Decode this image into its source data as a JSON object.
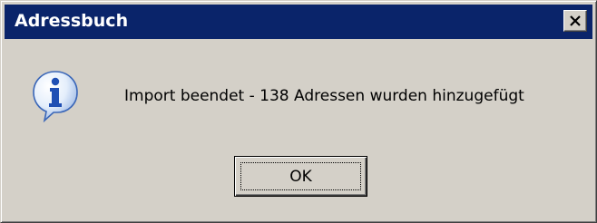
{
  "window": {
    "title": "Adressbuch"
  },
  "titlebar": {
    "close_icon": "close-icon",
    "background_color": "#0a246a"
  },
  "dialog": {
    "icon": "information-icon",
    "message": "Import beendet - 138 Adressen wurden hinzugefügt",
    "ok_label": "OK"
  }
}
